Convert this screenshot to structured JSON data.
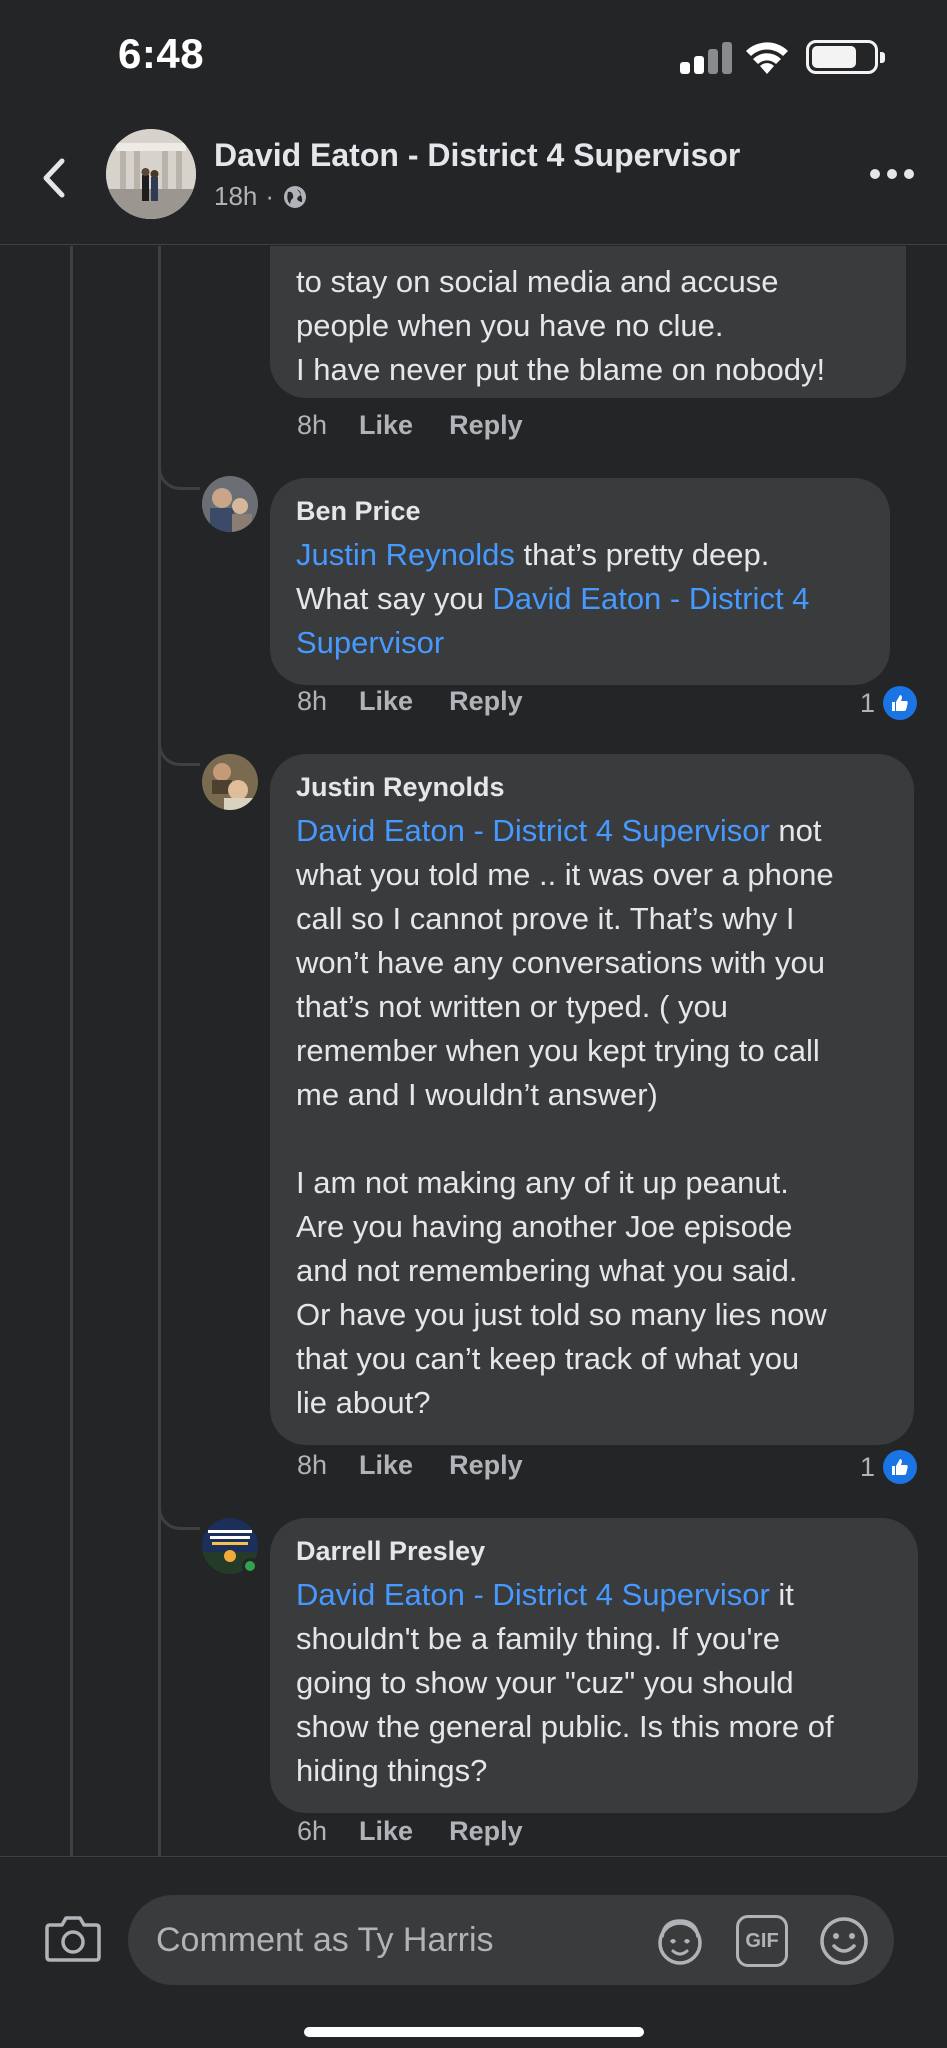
{
  "status_bar": {
    "time": "6:48"
  },
  "header": {
    "title": "David Eaton - District 4 Supervisor",
    "time": "18h",
    "separator": "·"
  },
  "comments": [
    {
      "lines": "to stay on social media and accuse\npeople when you have no clue.\nI have never put the blame on nobody!",
      "time": "8h",
      "like": "Like",
      "reply": "Reply"
    },
    {
      "author": "Ben Price",
      "mention": "Justin Reynolds",
      "text_after_mention": " that’s pretty deep.\nWhat say you ",
      "mention2": "David Eaton - District 4\nSupervisor",
      "time": "8h",
      "like": "Like",
      "reply": "Reply",
      "reactions": "1"
    },
    {
      "author": "Justin Reynolds",
      "mention": "David Eaton - District 4 Supervisor",
      "text_after_mention": " not\nwhat you told me .. it was over a phone\ncall so I cannot prove it. That’s why I\nwon’t have any conversations with you\nthat’s not written or typed. ( you\nremember when you kept trying to call\nme and I wouldn’t answer)\n\nI am not making any of it up peanut.\nAre you having another Joe episode\nand not remembering what you said.\nOr have you just told so many lies now\nthat you can’t keep track of what you\nlie about?",
      "time": "8h",
      "like": "Like",
      "reply": "Reply",
      "reactions": "1"
    },
    {
      "author": "Darrell Presley",
      "mention": "David Eaton - District 4 Supervisor",
      "text_after_mention": " it\nshouldn't be a family thing. If you're\ngoing to show your \"cuz\" you should\nshow the general public. Is this more of\nhiding things?",
      "time": "6h",
      "like": "Like",
      "reply": "Reply"
    }
  ],
  "composer": {
    "placeholder": "Comment as Ty Harris",
    "gif_label": "GIF"
  },
  "colors": {
    "mention": "#4599ff",
    "like_badge": "#1b74e4",
    "online": "#31a24c"
  },
  "icons": [
    "back-chevron-icon",
    "globe-icon",
    "more-icon",
    "thumbs-up-icon",
    "camera-icon",
    "avatar-sticker-icon",
    "gif-icon",
    "emoji-icon"
  ]
}
